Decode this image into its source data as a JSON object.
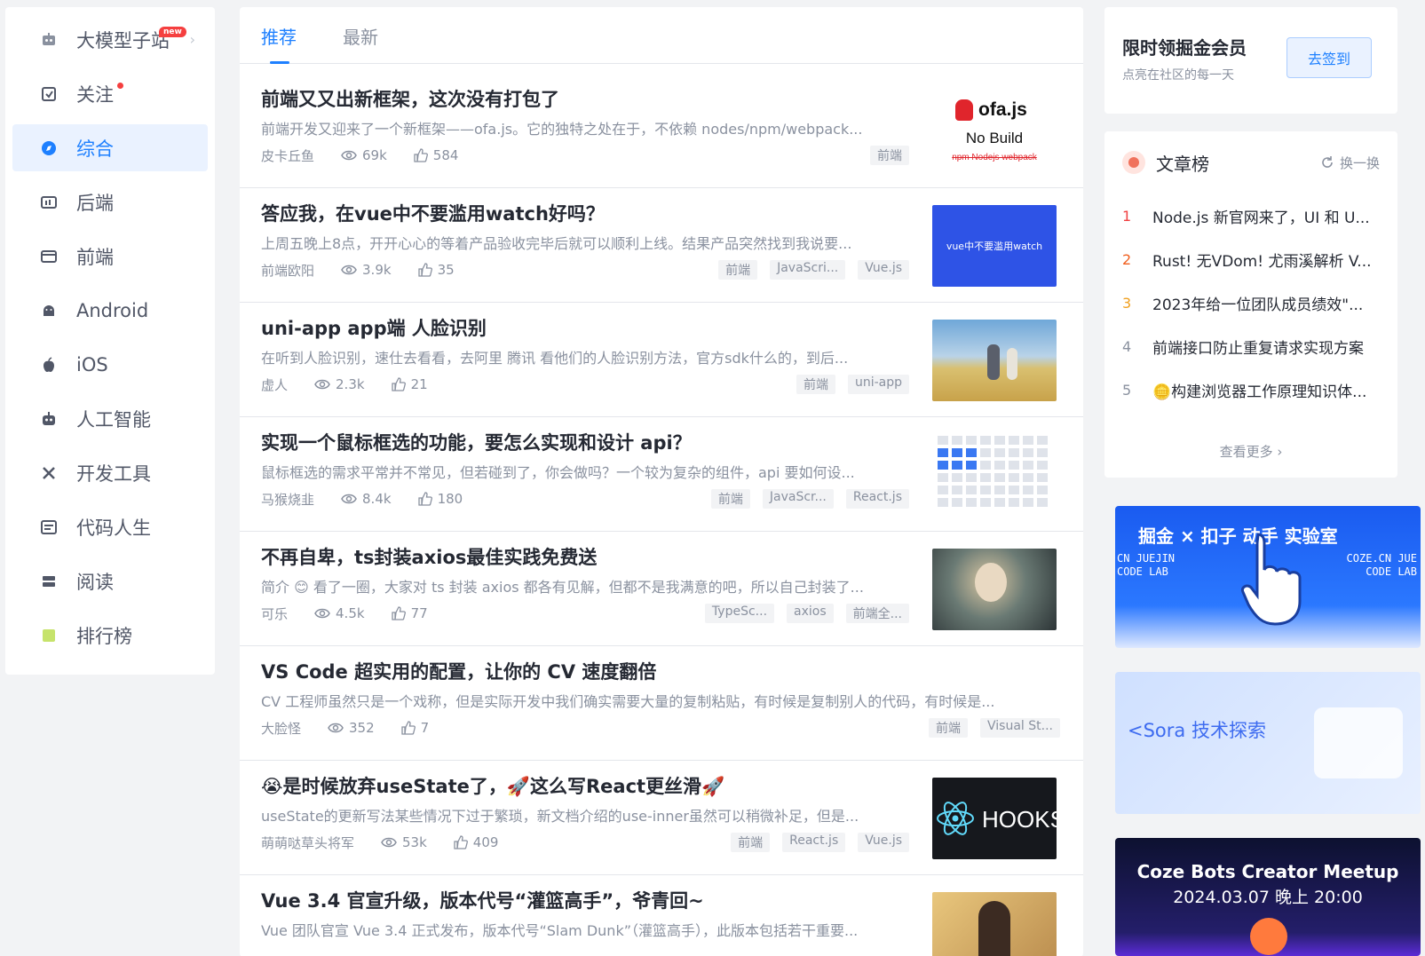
{
  "sidebar": {
    "items": [
      {
        "label": "大模型子站",
        "icon": "robot-icon",
        "badge": "new"
      },
      {
        "label": "关注",
        "icon": "follow-icon"
      },
      {
        "label": "综合",
        "icon": "compass-icon"
      },
      {
        "label": "后端",
        "icon": "backend-icon"
      },
      {
        "label": "前端",
        "icon": "frontend-icon"
      },
      {
        "label": "Android",
        "icon": "android-icon"
      },
      {
        "label": "iOS",
        "icon": "apple-icon"
      },
      {
        "label": "人工智能",
        "icon": "robot-head-icon"
      },
      {
        "label": "开发工具",
        "icon": "tools-icon"
      },
      {
        "label": "代码人生",
        "icon": "code-life-icon"
      },
      {
        "label": "阅读",
        "icon": "book-icon"
      },
      {
        "label": "排行榜",
        "icon": "ranking-icon"
      }
    ],
    "active_index": 2
  },
  "feed": {
    "tabs": [
      "推荐",
      "最新"
    ],
    "active_tab": 0,
    "articles": [
      {
        "title": "前端又又出新框架，这次没有打包了",
        "abstract": "前端开发又迎来了一个新框架——ofa.js。它的独特之处在于，不依赖 nodes/npm/webpack...",
        "author": "皮卡丘鱼",
        "views": "69k",
        "likes": "584",
        "tags": [
          "前端"
        ],
        "thumb": "ofajs"
      },
      {
        "title": "答应我，在vue中不要滥用watch好吗？",
        "abstract": "上周五晚上8点，开开心心的等着产品验收完毕后就可以顺利上线。结果产品突然找到我说要...",
        "author": "前端欧阳",
        "views": "3.9k",
        "likes": "35",
        "tags": [
          "前端",
          "JavaScri...",
          "Vue.js"
        ],
        "thumb": "watch"
      },
      {
        "title": "uni-app app端 人脸识别",
        "abstract": "在听到人脸识别，速仕去看看，去阿里 腾讯 看他们的人脸识别方法，官方sdk什么的，到后...",
        "author": "虚人",
        "views": "2.3k",
        "likes": "21",
        "tags": [
          "前端",
          "uni-app"
        ],
        "thumb": "anime"
      },
      {
        "title": "实现一个鼠标框选的功能，要怎么实现和设计 api？",
        "abstract": "鼠标框选的需求平常并不常见，但若碰到了，你会做吗？一个较为复杂的组件，api 要如何设...",
        "author": "马猴烧韭",
        "views": "8.4k",
        "likes": "180",
        "tags": [
          "前端",
          "JavaScr...",
          "React.js"
        ],
        "thumb": "grid"
      },
      {
        "title": "不再自卑，ts封装axios最佳实践免费送",
        "abstract": "简介 😊 看了一圈，大家对 ts 封装 axios 都各有见解，但都不是我满意的吧，所以自己封装了...",
        "author": "可乐",
        "views": "4.5k",
        "likes": "77",
        "tags": [
          "TypeSc...",
          "axios",
          "前端全..."
        ],
        "thumb": "girl"
      },
      {
        "title": "VS Code 超实用的配置，让你的 CV 速度翻倍",
        "abstract": "CV 工程师虽然只是一个戏称，但是实际开发中我们确实需要大量的复制粘贴，有时候是复制别人的代码，有时候是...",
        "author": "大脸怪",
        "views": "352",
        "likes": "7",
        "tags": [
          "前端",
          "Visual St..."
        ],
        "thumb": null
      },
      {
        "title": "😭是时候放弃useState了，🚀这么写React更丝滑🚀",
        "abstract": "useState的更新写法某些情况下过于繁琐，新文档介绍的use-inner虽然可以稍微补足，但是...",
        "author": "萌萌哒草头将军",
        "views": "53k",
        "likes": "409",
        "tags": [
          "前端",
          "React.js",
          "Vue.js"
        ],
        "thumb": "hooks"
      },
      {
        "title": "Vue 3.4 官宣升级，版本代号“灌篮高手”，爷青回~",
        "abstract": "Vue 团队官宣 Vue 3.4 正式发布，版本代号“Slam Dunk”（灌篮高手），此版本包括若干重要...",
        "author": "",
        "views": "",
        "likes": "",
        "tags": [],
        "thumb": "slamdunk"
      }
    ],
    "thumb_text": {
      "ofa_name": "ofa.js",
      "ofa_nobuild": "No Build",
      "ofa_tools": "npm  Nodejs  webpack",
      "watch_text": "vue中不要滥用watch",
      "hooks_text": "HOOKS"
    }
  },
  "vip": {
    "title": "限时领掘金会员",
    "subtitle": "点亮在社区的每一天",
    "button": "去签到"
  },
  "ranking": {
    "title": "文章榜",
    "refresh": "换一换",
    "items": [
      {
        "num": "1",
        "text": "Node.js 新官网来了，UI 和 U..."
      },
      {
        "num": "2",
        "text": "Rust! 无VDom! 尤雨溪解析 V..."
      },
      {
        "num": "3",
        "text": "2023年给一位团队成员绩效\"..."
      },
      {
        "num": "4",
        "text": "前端接口防止重复请求实现方案"
      },
      {
        "num": "5",
        "text": "🪙构建浏览器工作原理知识体..."
      }
    ],
    "see_more": "查看更多 ›"
  },
  "banners": {
    "b1_title": "掘金 × 扣子  动手 实验室",
    "b1_left": "CN JUEJIN CODE LAB",
    "b1_right": "COZE.CN JUE CODE LAB",
    "b2_title": "<Sora 技术探索",
    "b3_title": "Coze Bots Creator Meetup",
    "b3_date": "2024.03.07 晚上 20:00"
  },
  "colors": {
    "accent": "#1e80ff",
    "red": "#f53f3f",
    "text": "#252933",
    "muted": "#8a919f"
  }
}
